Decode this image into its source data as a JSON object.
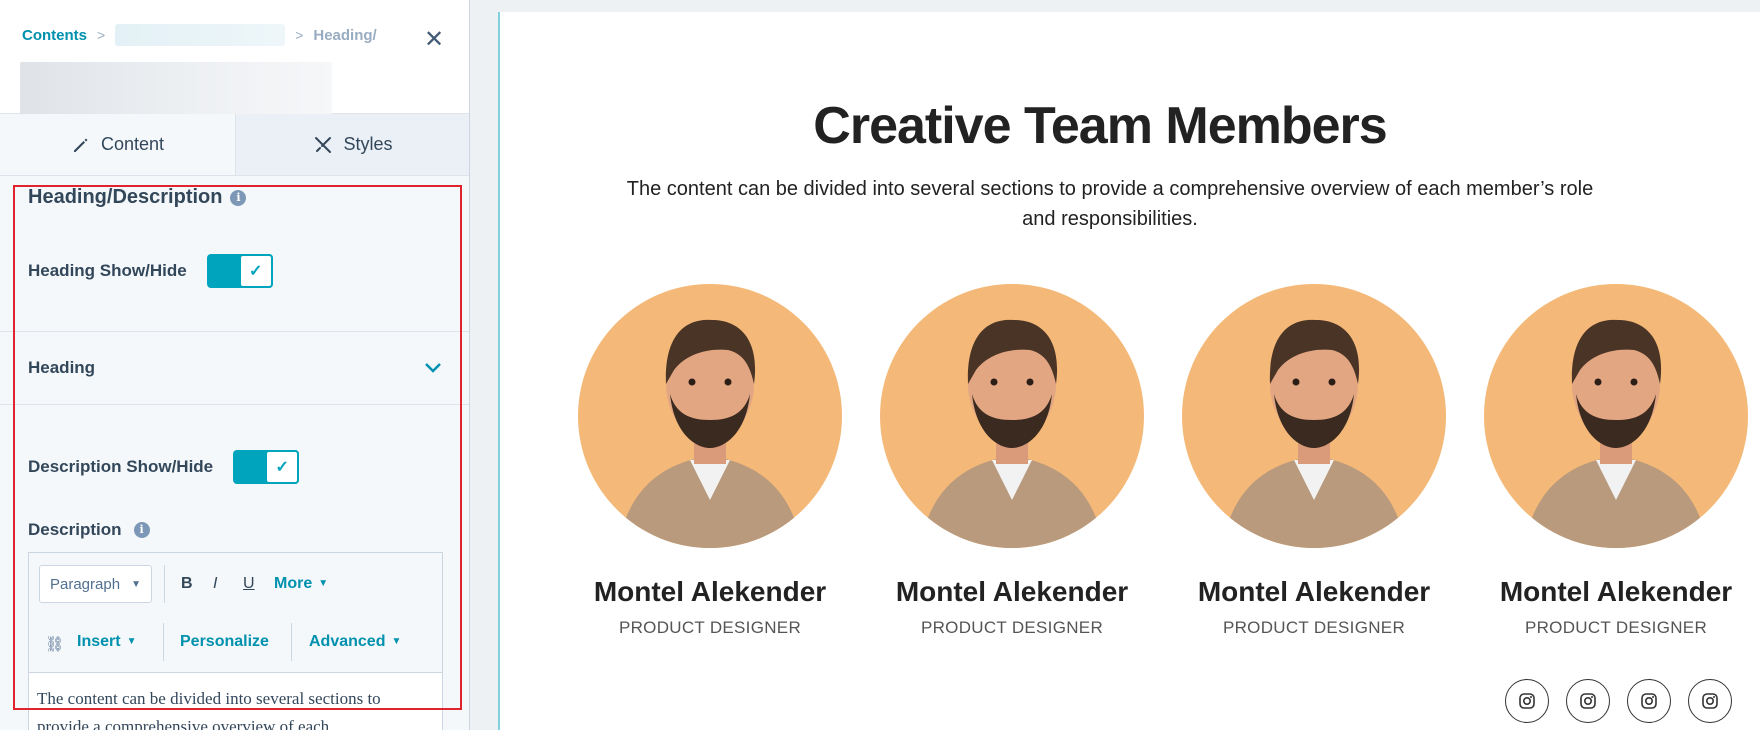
{
  "breadcrumb": {
    "root": "Contents",
    "separator": ">",
    "current": "Heading/"
  },
  "tabs": [
    {
      "label": "Content",
      "icon": "pencil-icon"
    },
    {
      "label": "Styles",
      "icon": "brush-icon"
    }
  ],
  "section": {
    "title": "Heading/Description",
    "heading_toggle_label": "Heading Show/Hide",
    "heading_toggle_on": true,
    "heading_accordion_label": "Heading",
    "description_toggle_label": "Description Show/Hide",
    "description_toggle_on": true,
    "description_label": "Description"
  },
  "editor": {
    "format_select": "Paragraph",
    "bold": "B",
    "italic": "I",
    "underline": "U",
    "more": "More",
    "insert": "Insert",
    "personalize": "Personalize",
    "advanced": "Advanced",
    "body_line1": "The content can be divided into several sections to",
    "body_line2": "provide a comprehensive overview of each"
  },
  "preview": {
    "title": "Creative Team Members",
    "description": "The content can be divided into several sections to provide a comprehensive overview of each member’s role and responsibilities.",
    "members": [
      {
        "name": "Montel Alekender",
        "role": "PRODUCT DESIGNER"
      },
      {
        "name": "Montel Alekender",
        "role": "PRODUCT DESIGNER"
      },
      {
        "name": "Montel Alekender",
        "role": "PRODUCT DESIGNER"
      },
      {
        "name": "Montel Alekender",
        "role": "PRODUCT DESIGNER"
      }
    ],
    "social_icons": [
      "instagram-icon",
      "instagram-icon",
      "instagram-icon",
      "instagram-icon"
    ]
  },
  "colors": {
    "accent": "#00a4bd",
    "link": "#0091ae",
    "highlight": "#e0242d",
    "avatar_bg": "#f4b878"
  }
}
